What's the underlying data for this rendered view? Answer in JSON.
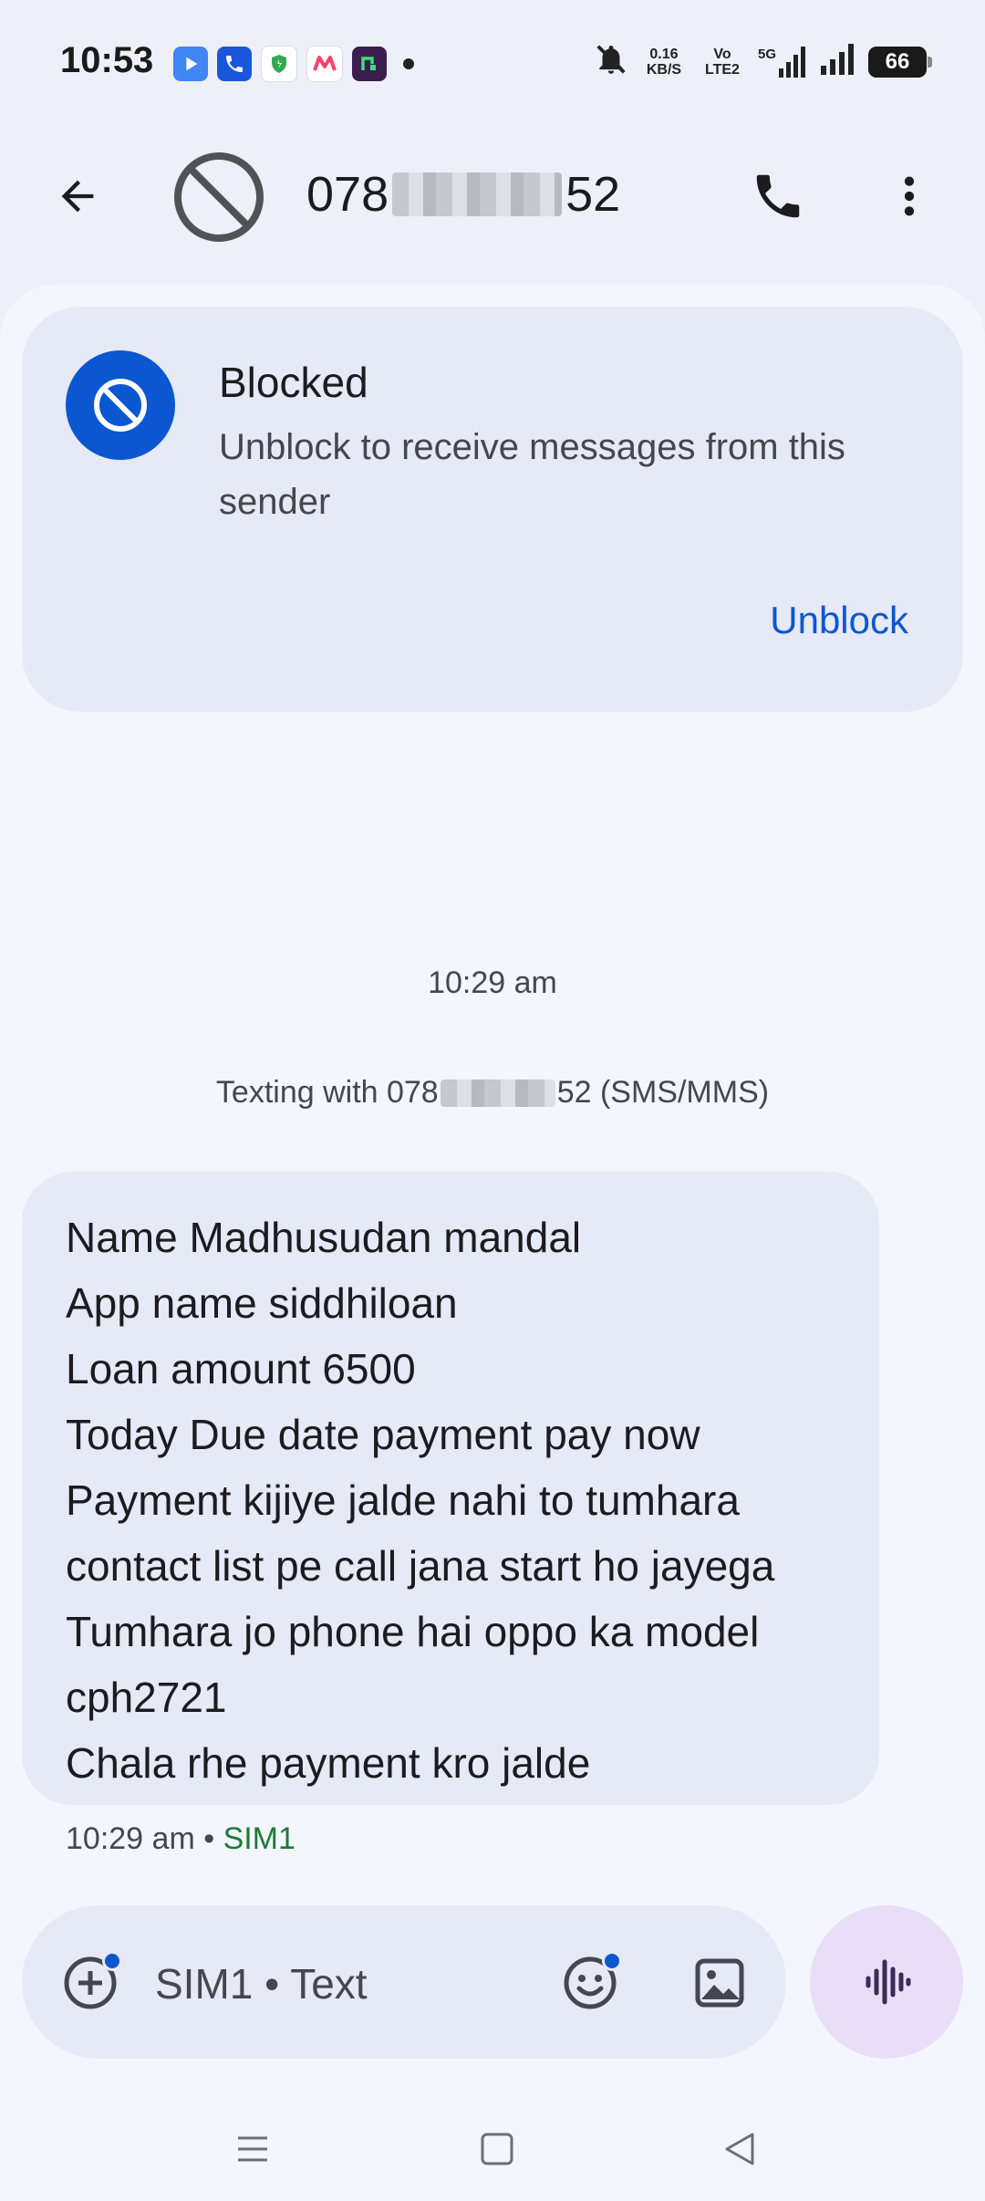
{
  "status_bar": {
    "time": "10:53",
    "notification_icons": [
      "video-app-icon",
      "phone-app-icon",
      "shield-app-icon",
      "myntra-app-icon",
      "n-app-icon"
    ],
    "net_speed": "0.16 KB/S",
    "volte": "Vo LTE2",
    "network": "5G",
    "battery": "66"
  },
  "header": {
    "title_prefix": "078",
    "title_suffix": "52"
  },
  "blocked_card": {
    "title": "Blocked",
    "description": "Unblock to receive messages from this sender",
    "action": "Unblock"
  },
  "conversation": {
    "timestamp": "10:29 am",
    "texting_prefix": "Texting with 078",
    "texting_suffix": "52 (SMS/MMS)",
    "message": "Name Madhusudan mandal\nApp name siddhiloan\nLoan amount 6500\nToday Due date payment pay now\nPayment kijiye jalde nahi to tumhara contact list pe call jana start ho jayega\nTumhara jo phone hai oppo ka model cph2721\nChala rhe payment kro jalde",
    "message_time": "10:29 am",
    "message_separator": " • ",
    "message_sim": "SIM1"
  },
  "composer": {
    "placeholder": "SIM1 • Text"
  },
  "colors": {
    "accent": "#0b57d0",
    "background": "#eef0f9",
    "bubble": "#e6e9f6",
    "voice_button": "#e9ddf7",
    "sim_label": "#1e7a35"
  }
}
